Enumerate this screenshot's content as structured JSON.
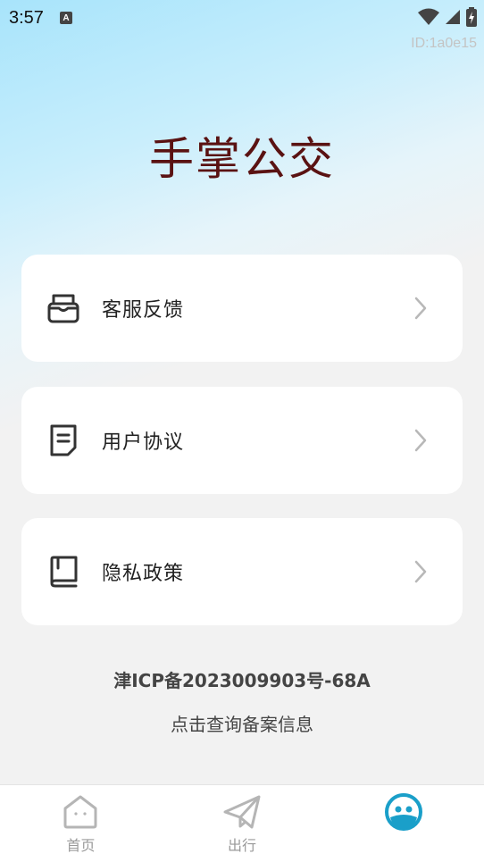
{
  "status_bar": {
    "time": "3:57",
    "notification_badge": "A"
  },
  "id_label": "ID:1a0e15",
  "app_title": "手掌公交",
  "menu": [
    {
      "label": "客服反馈",
      "icon": "inbox-icon"
    },
    {
      "label": "用户协议",
      "icon": "document-icon"
    },
    {
      "label": "隐私政策",
      "icon": "book-icon"
    }
  ],
  "icp_number": "津ICP备2023009903号-68A",
  "icp_query_link": "点击查询备案信息",
  "tabbar": {
    "tabs": [
      {
        "label": "首页",
        "icon": "home-icon"
      },
      {
        "label": "出行",
        "icon": "paper-plane-icon"
      },
      {
        "label": "",
        "icon": "profile-face-icon",
        "active": true
      }
    ]
  },
  "colors": {
    "title": "#5a1212",
    "active_tab": "#1a9fc9",
    "inactive_tab": "#b5b5b5"
  }
}
